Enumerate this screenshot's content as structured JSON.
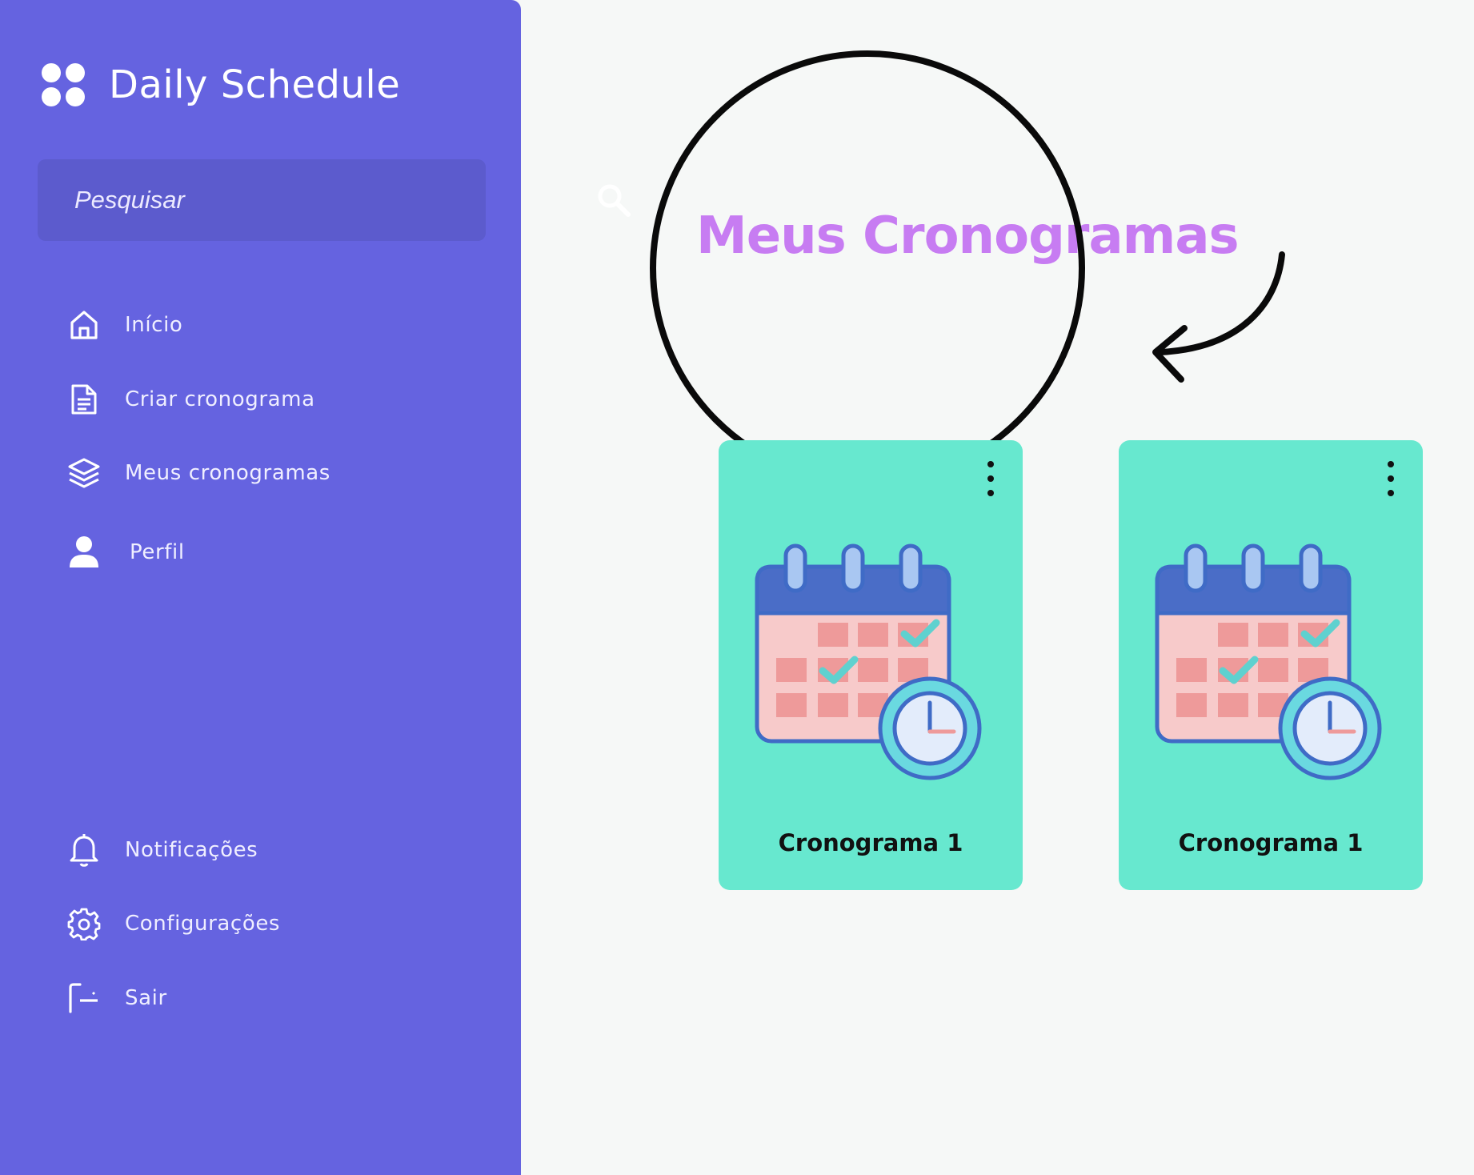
{
  "app": {
    "title": "Daily Schedule"
  },
  "sidebar": {
    "search_placeholder": "Pesquisar",
    "nav_top": [
      {
        "label": "Início",
        "icon": "home-icon"
      },
      {
        "label": "Criar cronograma",
        "icon": "document-icon"
      },
      {
        "label": "Meus cronogramas",
        "icon": "layers-icon"
      },
      {
        "label": "Perfil",
        "icon": "user-icon"
      }
    ],
    "nav_bottom": [
      {
        "label": "Notificações",
        "icon": "bell-icon"
      },
      {
        "label": "Configurações",
        "icon": "gear-icon"
      },
      {
        "label": "Sair",
        "icon": "logout-icon"
      }
    ]
  },
  "main": {
    "title": "Meus Cronogramas",
    "cards": [
      {
        "title": "Cronograma 1",
        "icon": "calendar-clock-illustration"
      },
      {
        "title": "Cronograma 1",
        "icon": "calendar-clock-illustration"
      }
    ]
  },
  "colors": {
    "sidebar": "#6563e0",
    "search_box": "#5c5bcd",
    "title": "#c77cf2",
    "card": "#67e8cf",
    "background": "#f6f8f7"
  }
}
